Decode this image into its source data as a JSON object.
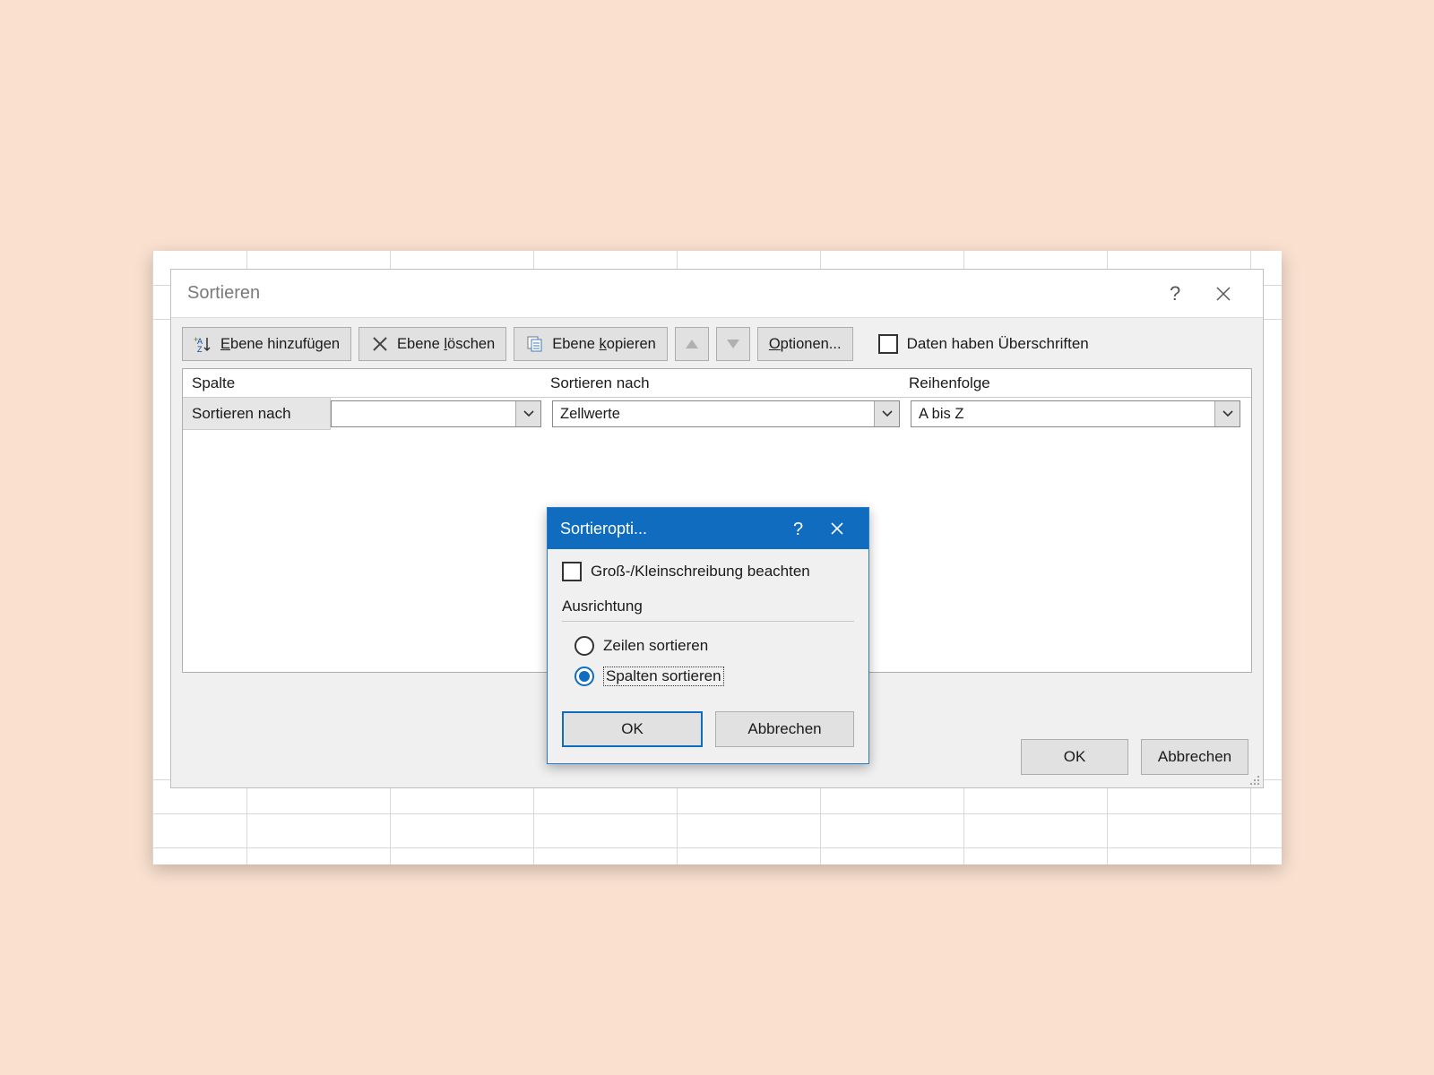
{
  "sortDialog": {
    "title": "Sortieren",
    "toolbar": {
      "addLevel": "Ebene hinzufügen",
      "deleteLevel": "Ebene löschen",
      "copyLevel": "Ebene kopieren",
      "options": "Optionen...",
      "headersCheckbox": "Daten haben Überschriften"
    },
    "headers": {
      "column": "Spalte",
      "sortOn": "Sortieren nach",
      "order": "Reihenfolge"
    },
    "row": {
      "label": "Sortieren nach",
      "column": "",
      "sortOn": "Zellwerte",
      "order": "A bis Z"
    },
    "buttons": {
      "ok": "OK",
      "cancel": "Abbrechen"
    }
  },
  "optionsDialog": {
    "title": "Sortieropti...",
    "caseSensitive": "Groß-/Kleinschreibung beachten",
    "orientationLabel": "Ausrichtung",
    "sortRows": "Zeilen sortieren",
    "sortColumns": "Spalten sortieren",
    "ok": "OK",
    "cancel": "Abbrechen"
  }
}
